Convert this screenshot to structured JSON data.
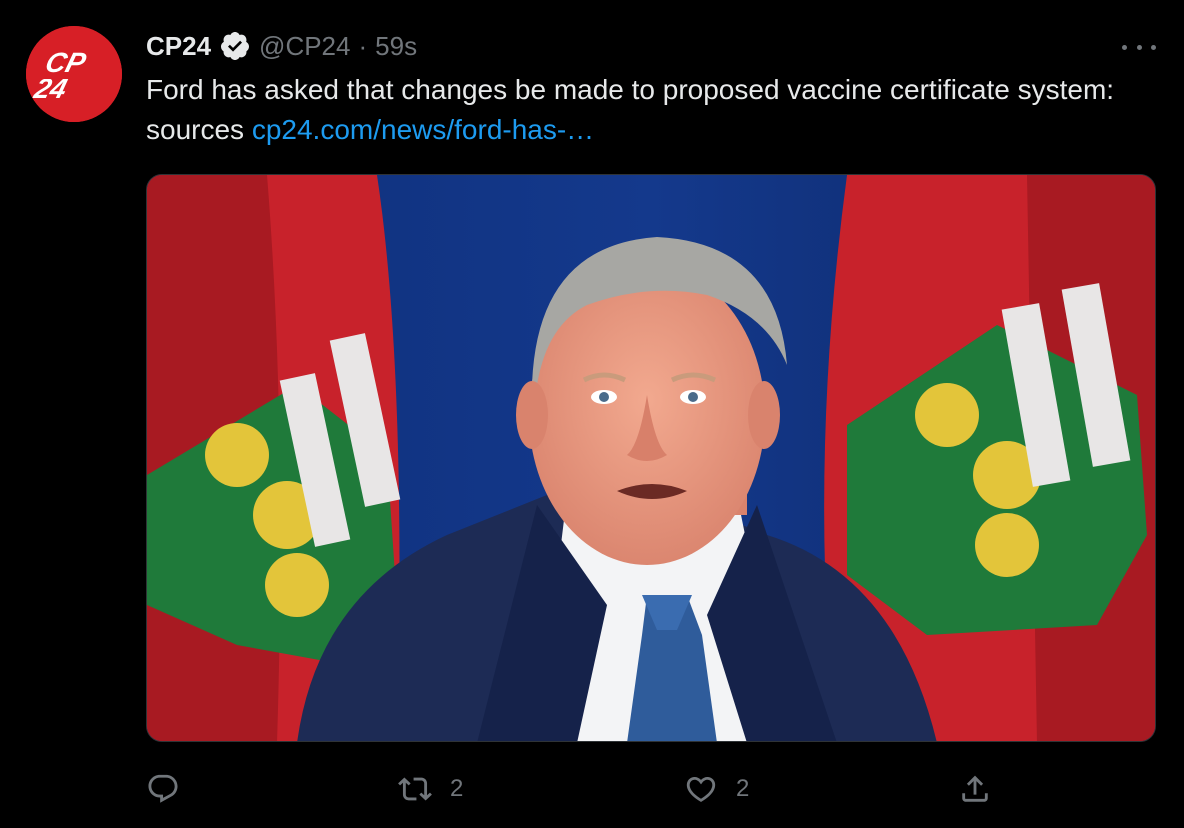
{
  "tweet": {
    "display_name": "CP24",
    "handle": "@CP24",
    "separator": "·",
    "timestamp": "59s",
    "text": "Ford has asked that changes be made to proposed vaccine certificate system: sources ",
    "link_text": "cp24.com/news/ford-has-…",
    "avatar_text": "CP24",
    "icons": {
      "verified": "verified-badge-icon",
      "more": "more-icon",
      "reply": "reply-icon",
      "retweet": "retweet-icon",
      "like": "heart-icon",
      "share": "share-icon"
    },
    "stats": {
      "retweets": "2",
      "likes": "2"
    }
  },
  "colors": {
    "background": "#000000",
    "text": "#e7e9ea",
    "muted": "#71767b",
    "link": "#1d9bf0",
    "avatar_red": "#d71f26"
  }
}
